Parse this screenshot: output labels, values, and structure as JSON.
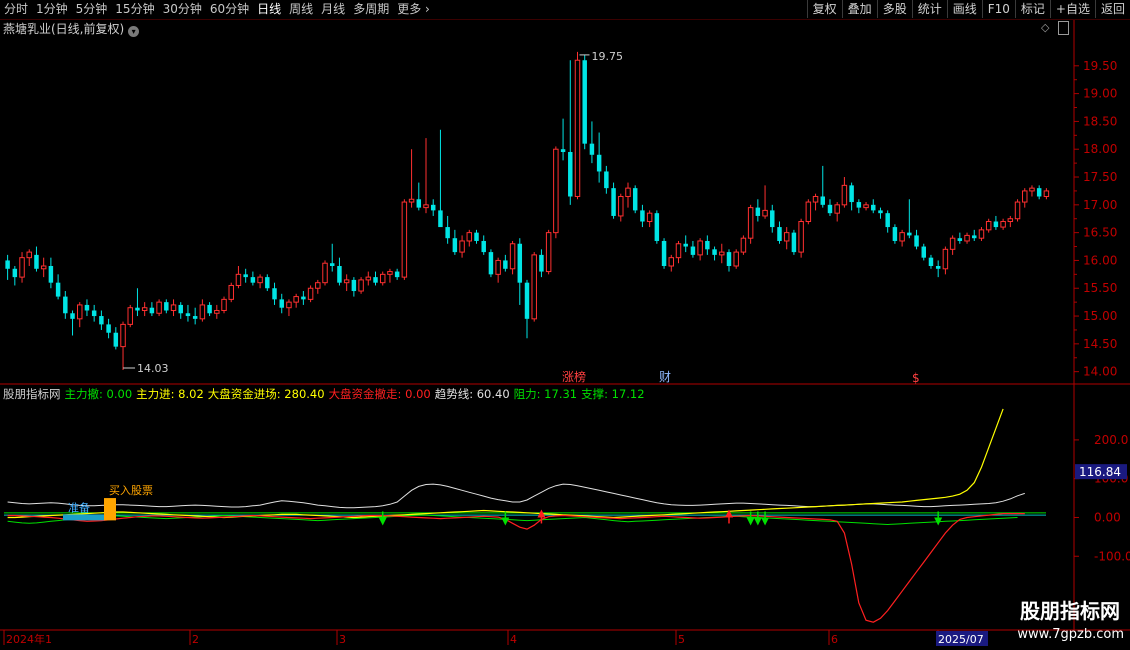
{
  "toolbar": {
    "left_items": [
      "分时",
      "1分钟",
      "5分钟",
      "15分钟",
      "30分钟",
      "60分钟",
      "日线",
      "周线",
      "月线",
      "多周期",
      "更多"
    ],
    "active_item": "日线",
    "right_buttons": [
      "复权",
      "叠加",
      "多股",
      "统计",
      "画线",
      "F10",
      "标记",
      "+自选",
      "返回"
    ]
  },
  "main_title": "燕塘乳业(日线,前复权)",
  "price_axis": {
    "ticks": [
      "19.50",
      "19.00",
      "18.50",
      "18.00",
      "17.50",
      "17.00",
      "16.50",
      "16.00",
      "15.50",
      "15.00",
      "14.50",
      "14.00"
    ]
  },
  "high_label": "19.75",
  "low_label": "14.03",
  "event_markers": [
    "涨榜",
    "财",
    "$"
  ],
  "indicator": {
    "name": "股朋指标网",
    "items": [
      {
        "label": "主力撤:",
        "value": "0.00",
        "color": "#00e000"
      },
      {
        "label": "主力进:",
        "value": "8.02",
        "color": "#ffff00"
      },
      {
        "label": "大盘资金进场:",
        "value": "280.40",
        "color": "#ffff00"
      },
      {
        "label": "大盘资金撤走:",
        "value": "0.00",
        "color": "#ff2020"
      },
      {
        "label": "趋势线:",
        "value": "60.40",
        "color": "#e0e0e0"
      },
      {
        "label": "阻力:",
        "value": "17.31",
        "color": "#00e000"
      },
      {
        "label": "支撑:",
        "value": "17.12",
        "color": "#00e000"
      }
    ],
    "ticks": [
      "200.0",
      "100.0",
      "0.00",
      "-100.0"
    ],
    "current_value": "116.84",
    "label_prepare": "准备",
    "label_buy": "买入股票"
  },
  "date_axis": [
    "2024年1",
    "2",
    "3",
    "4",
    "5",
    "6",
    "2025/07"
  ],
  "watermark": {
    "line1": "股朋指标网",
    "line2": "www.7gpzb.com"
  },
  "colors": {
    "up": "#ff3030",
    "down": "#00e5e5",
    "axis": "#b00000"
  },
  "chart_data": {
    "type": "candlestick",
    "title": "燕塘乳业(日线,前复权)",
    "ylim": [
      13.85,
      20.0
    ],
    "high": 19.75,
    "low": 14.03,
    "candles": [
      [
        16.0,
        16.1,
        15.65,
        15.85
      ],
      [
        15.85,
        15.9,
        15.55,
        15.7
      ],
      [
        15.7,
        16.15,
        15.6,
        16.05
      ],
      [
        16.05,
        16.2,
        15.9,
        16.15
      ],
      [
        16.1,
        16.25,
        15.8,
        15.85
      ],
      [
        15.85,
        16.05,
        15.7,
        15.9
      ],
      [
        15.9,
        16.05,
        15.5,
        15.6
      ],
      [
        15.6,
        15.75,
        15.3,
        15.35
      ],
      [
        15.35,
        15.45,
        14.95,
        15.05
      ],
      [
        15.05,
        15.1,
        14.65,
        14.95
      ],
      [
        14.95,
        15.25,
        14.8,
        15.2
      ],
      [
        15.2,
        15.3,
        15.0,
        15.1
      ],
      [
        15.1,
        15.2,
        14.9,
        15.0
      ],
      [
        15.0,
        15.1,
        14.75,
        14.85
      ],
      [
        14.85,
        14.95,
        14.6,
        14.7
      ],
      [
        14.7,
        14.8,
        14.4,
        14.45
      ],
      [
        14.45,
        14.9,
        14.03,
        14.85
      ],
      [
        14.85,
        15.2,
        14.8,
        15.15
      ],
      [
        15.15,
        15.5,
        15.0,
        15.1
      ],
      [
        15.1,
        15.25,
        15.0,
        15.15
      ],
      [
        15.15,
        15.25,
        15.0,
        15.05
      ],
      [
        15.05,
        15.3,
        15.0,
        15.25
      ],
      [
        15.25,
        15.3,
        15.05,
        15.1
      ],
      [
        15.1,
        15.3,
        15.0,
        15.2
      ],
      [
        15.2,
        15.25,
        14.95,
        15.05
      ],
      [
        15.05,
        15.2,
        14.9,
        15.0
      ],
      [
        15.0,
        15.15,
        14.85,
        14.95
      ],
      [
        14.95,
        15.3,
        14.9,
        15.2
      ],
      [
        15.2,
        15.25,
        15.0,
        15.05
      ],
      [
        15.05,
        15.2,
        14.95,
        15.1
      ],
      [
        15.1,
        15.35,
        15.05,
        15.3
      ],
      [
        15.3,
        15.6,
        15.25,
        15.55
      ],
      [
        15.55,
        15.9,
        15.5,
        15.75
      ],
      [
        15.75,
        15.85,
        15.6,
        15.7
      ],
      [
        15.7,
        15.8,
        15.55,
        15.6
      ],
      [
        15.6,
        15.75,
        15.5,
        15.7
      ],
      [
        15.7,
        15.75,
        15.45,
        15.5
      ],
      [
        15.5,
        15.6,
        15.2,
        15.3
      ],
      [
        15.3,
        15.4,
        15.05,
        15.15
      ],
      [
        15.15,
        15.3,
        15.0,
        15.25
      ],
      [
        15.25,
        15.4,
        15.15,
        15.35
      ],
      [
        15.35,
        15.45,
        15.2,
        15.3
      ],
      [
        15.3,
        15.55,
        15.25,
        15.5
      ],
      [
        15.5,
        15.65,
        15.4,
        15.6
      ],
      [
        15.6,
        16.0,
        15.55,
        15.95
      ],
      [
        15.95,
        16.3,
        15.8,
        15.9
      ],
      [
        15.9,
        16.05,
        15.55,
        15.6
      ],
      [
        15.6,
        15.75,
        15.45,
        15.65
      ],
      [
        15.65,
        15.7,
        15.35,
        15.45
      ],
      [
        15.45,
        15.7,
        15.4,
        15.65
      ],
      [
        15.65,
        15.8,
        15.55,
        15.7
      ],
      [
        15.7,
        15.8,
        15.55,
        15.6
      ],
      [
        15.6,
        15.8,
        15.55,
        15.75
      ],
      [
        15.75,
        15.85,
        15.6,
        15.8
      ],
      [
        15.8,
        15.85,
        15.65,
        15.7
      ],
      [
        15.7,
        17.1,
        15.65,
        17.05
      ],
      [
        17.05,
        18.0,
        16.95,
        17.1
      ],
      [
        17.1,
        17.4,
        16.9,
        16.95
      ],
      [
        16.95,
        18.2,
        16.85,
        17.0
      ],
      [
        17.0,
        17.1,
        16.8,
        16.9
      ],
      [
        16.9,
        18.35,
        16.7,
        16.6
      ],
      [
        16.6,
        16.8,
        16.3,
        16.4
      ],
      [
        16.4,
        16.55,
        16.1,
        16.15
      ],
      [
        16.15,
        16.45,
        16.05,
        16.35
      ],
      [
        16.35,
        16.55,
        16.25,
        16.5
      ],
      [
        16.5,
        16.55,
        16.3,
        16.35
      ],
      [
        16.35,
        16.45,
        16.1,
        16.15
      ],
      [
        16.15,
        16.2,
        15.7,
        15.75
      ],
      [
        15.75,
        16.05,
        15.6,
        16.0
      ],
      [
        16.0,
        16.1,
        15.8,
        15.85
      ],
      [
        15.85,
        16.35,
        15.75,
        16.3
      ],
      [
        16.3,
        16.4,
        15.2,
        15.6
      ],
      [
        15.6,
        15.65,
        14.6,
        14.95
      ],
      [
        14.95,
        16.15,
        14.9,
        16.1
      ],
      [
        16.1,
        16.2,
        15.7,
        15.8
      ],
      [
        15.8,
        16.55,
        15.75,
        16.5
      ],
      [
        16.5,
        18.05,
        16.4,
        18.0
      ],
      [
        18.0,
        18.55,
        17.8,
        17.95
      ],
      [
        17.95,
        19.6,
        17.0,
        17.15
      ],
      [
        17.15,
        19.75,
        17.1,
        19.6
      ],
      [
        19.6,
        19.7,
        18.0,
        18.1
      ],
      [
        18.1,
        18.5,
        17.75,
        17.9
      ],
      [
        17.9,
        18.3,
        17.4,
        17.6
      ],
      [
        17.6,
        17.7,
        17.2,
        17.3
      ],
      [
        17.3,
        17.4,
        16.75,
        16.8
      ],
      [
        16.8,
        17.2,
        16.7,
        17.15
      ],
      [
        17.15,
        17.4,
        16.95,
        17.3
      ],
      [
        17.3,
        17.35,
        16.85,
        16.9
      ],
      [
        16.9,
        17.0,
        16.6,
        16.7
      ],
      [
        16.7,
        16.9,
        16.6,
        16.85
      ],
      [
        16.85,
        16.9,
        16.3,
        16.35
      ],
      [
        16.35,
        16.4,
        15.85,
        15.9
      ],
      [
        15.9,
        16.1,
        15.8,
        16.05
      ],
      [
        16.05,
        16.35,
        15.95,
        16.3
      ],
      [
        16.3,
        16.45,
        16.15,
        16.25
      ],
      [
        16.25,
        16.35,
        16.05,
        16.1
      ],
      [
        16.1,
        16.4,
        16.0,
        16.35
      ],
      [
        16.35,
        16.45,
        16.1,
        16.2
      ],
      [
        16.2,
        16.25,
        16.0,
        16.1
      ],
      [
        16.1,
        16.3,
        15.95,
        16.15
      ],
      [
        16.15,
        16.2,
        15.8,
        15.9
      ],
      [
        15.9,
        16.2,
        15.85,
        16.15
      ],
      [
        16.15,
        16.45,
        16.1,
        16.4
      ],
      [
        16.4,
        17.0,
        16.3,
        16.95
      ],
      [
        16.95,
        17.1,
        16.7,
        16.8
      ],
      [
        16.8,
        17.35,
        16.75,
        16.9
      ],
      [
        16.9,
        17.0,
        16.5,
        16.6
      ],
      [
        16.6,
        16.7,
        16.3,
        16.35
      ],
      [
        16.35,
        16.6,
        16.2,
        16.5
      ],
      [
        16.5,
        16.55,
        16.1,
        16.15
      ],
      [
        16.15,
        16.75,
        16.05,
        16.7
      ],
      [
        16.7,
        17.1,
        16.65,
        17.05
      ],
      [
        17.05,
        17.2,
        16.9,
        17.15
      ],
      [
        17.15,
        17.7,
        16.95,
        17.0
      ],
      [
        17.0,
        17.1,
        16.8,
        16.85
      ],
      [
        16.85,
        17.05,
        16.7,
        17.0
      ],
      [
        17.0,
        17.5,
        16.95,
        17.35
      ],
      [
        17.35,
        17.4,
        16.9,
        17.05
      ],
      [
        17.05,
        17.1,
        16.85,
        16.95
      ],
      [
        16.95,
        17.05,
        16.9,
        17.0
      ],
      [
        17.0,
        17.1,
        16.85,
        16.9
      ],
      [
        16.9,
        16.95,
        16.75,
        16.85
      ],
      [
        16.85,
        16.9,
        16.5,
        16.6
      ],
      [
        16.6,
        16.65,
        16.3,
        16.35
      ],
      [
        16.35,
        16.55,
        16.25,
        16.5
      ],
      [
        16.5,
        17.1,
        16.4,
        16.45
      ],
      [
        16.45,
        16.55,
        16.2,
        16.25
      ],
      [
        16.25,
        16.3,
        16.0,
        16.05
      ],
      [
        16.05,
        16.1,
        15.85,
        15.9
      ],
      [
        15.9,
        16.0,
        15.7,
        15.85
      ],
      [
        15.85,
        16.25,
        15.75,
        16.2
      ],
      [
        16.2,
        16.45,
        16.1,
        16.4
      ],
      [
        16.4,
        16.5,
        16.3,
        16.35
      ],
      [
        16.35,
        16.5,
        16.3,
        16.45
      ],
      [
        16.45,
        16.55,
        16.35,
        16.4
      ],
      [
        16.4,
        16.6,
        16.35,
        16.55
      ],
      [
        16.55,
        16.75,
        16.5,
        16.7
      ],
      [
        16.7,
        16.8,
        16.55,
        16.6
      ],
      [
        16.6,
        16.75,
        16.55,
        16.7
      ],
      [
        16.7,
        16.8,
        16.6,
        16.75
      ],
      [
        16.75,
        17.1,
        16.7,
        17.05
      ],
      [
        17.05,
        17.3,
        16.95,
        17.25
      ],
      [
        17.25,
        17.35,
        17.15,
        17.3
      ],
      [
        17.3,
        17.35,
        17.1,
        17.15
      ],
      [
        17.15,
        17.3,
        17.1,
        17.25
      ]
    ],
    "indicator_series": {
      "ylim": [
        -285,
        290
      ],
      "trend": [
        40,
        38,
        36,
        35,
        36,
        37,
        38,
        37,
        35,
        33,
        31,
        30,
        30,
        31,
        32,
        33,
        33,
        32,
        31,
        30,
        29,
        28,
        28,
        29,
        30,
        31,
        32,
        31,
        30,
        29,
        28,
        27,
        27,
        28,
        30,
        32,
        36,
        40,
        43,
        42,
        40,
        38,
        35,
        32,
        30,
        28,
        26,
        25,
        25,
        26,
        27,
        28,
        30,
        34,
        40,
        55,
        70,
        80,
        85,
        86,
        84,
        80,
        75,
        70,
        65,
        60,
        55,
        50,
        46,
        43,
        40,
        40,
        45,
        55,
        65,
        75,
        82,
        86,
        85,
        82,
        78,
        74,
        70,
        66,
        62,
        58,
        54,
        50,
        46,
        42,
        38,
        35,
        33,
        32,
        31,
        31,
        32,
        33,
        34,
        35,
        36,
        37,
        37,
        36,
        35,
        34,
        33,
        32,
        31,
        30,
        29,
        28,
        28,
        29,
        30,
        31,
        32,
        33,
        34,
        35,
        35,
        34,
        33,
        32,
        31,
        30,
        29,
        28,
        28,
        29,
        30,
        31,
        32,
        33,
        34,
        35,
        36,
        38,
        42,
        48,
        56,
        62
      ],
      "red": [
        5,
        5,
        4,
        3,
        2,
        1,
        0,
        -2,
        -4,
        -6,
        -8,
        -10,
        -9,
        -8,
        -6,
        -4,
        -2,
        0,
        2,
        3,
        4,
        4,
        3,
        2,
        1,
        0,
        -1,
        -2,
        -1,
        0,
        1,
        2,
        3,
        4,
        5,
        4,
        3,
        2,
        1,
        0,
        -1,
        -2,
        -3,
        -2,
        -1,
        0,
        1,
        2,
        3,
        4,
        5,
        5,
        5,
        4,
        3,
        2,
        1,
        0,
        -1,
        -2,
        -3,
        -2,
        -1,
        0,
        1,
        2,
        3,
        2,
        1,
        -5,
        -15,
        -25,
        -30,
        -20,
        -5,
        2,
        4,
        5,
        4,
        3,
        2,
        1,
        0,
        -1,
        -2,
        -3,
        -2,
        -1,
        0,
        1,
        2,
        3,
        2,
        1,
        0,
        -1,
        -2,
        -1,
        0,
        1,
        2,
        3,
        4,
        5,
        4,
        3,
        2,
        1,
        0,
        -1,
        -2,
        -3,
        -4,
        -5,
        -6,
        -10,
        -40,
        -120,
        -220,
        -265,
        -270,
        -260,
        -240,
        -215,
        -190,
        -165,
        -140,
        -115,
        -90,
        -65,
        -40,
        -20,
        -5,
        0,
        2,
        4,
        6,
        8,
        10,
        10,
        10,
        10
      ],
      "yellow": [
        0,
        0,
        1,
        2,
        3,
        4,
        5,
        6,
        7,
        8,
        9,
        10,
        11,
        12,
        13,
        14,
        14,
        13,
        12,
        11,
        10,
        9,
        8,
        7,
        6,
        5,
        4,
        3,
        2,
        1,
        0,
        1,
        2,
        3,
        4,
        5,
        6,
        7,
        8,
        8,
        8,
        7,
        6,
        5,
        4,
        3,
        2,
        1,
        0,
        1,
        2,
        3,
        4,
        5,
        6,
        7,
        8,
        9,
        10,
        11,
        12,
        13,
        14,
        15,
        16,
        17,
        18,
        17,
        16,
        15,
        14,
        13,
        12,
        11,
        10,
        9,
        8,
        7,
        6,
        5,
        4,
        3,
        2,
        1,
        0,
        1,
        2,
        3,
        4,
        5,
        6,
        7,
        8,
        9,
        10,
        11,
        12,
        13,
        14,
        15,
        16,
        17,
        18,
        19,
        20,
        21,
        22,
        23,
        24,
        25,
        26,
        27,
        28,
        29,
        30,
        31,
        32,
        33,
        34,
        35,
        36,
        37,
        38,
        39,
        40,
        42,
        44,
        46,
        48,
        50,
        52,
        55,
        60,
        70,
        90,
        130,
        180,
        230,
        280
      ],
      "green": [
        -10,
        -12,
        -14,
        -15,
        -14,
        -12,
        -10,
        -8,
        -6,
        -4,
        -2,
        0,
        2,
        3,
        4,
        4,
        3,
        2,
        1,
        0,
        -1,
        -2,
        -3,
        -2,
        -1,
        0,
        1,
        2,
        3,
        4,
        5,
        4,
        3,
        2,
        1,
        0,
        -1,
        -2,
        -3,
        -4,
        -5,
        -6,
        -7,
        -8,
        -7,
        -6,
        -5,
        -4,
        -3,
        -2,
        -1,
        0,
        1,
        2,
        3,
        4,
        5,
        6,
        6,
        5,
        4,
        3,
        2,
        1,
        0,
        -1,
        -2,
        -3,
        -4,
        -5,
        -6,
        -7,
        -8,
        -7,
        -6,
        -5,
        -4,
        -3,
        -2,
        -1,
        0,
        -2,
        -4,
        -6,
        -8,
        -10,
        -11,
        -10,
        -9,
        -8,
        -7,
        -6,
        -5,
        -4,
        -3,
        -2,
        -1,
        0,
        1,
        2,
        3,
        3,
        2,
        1,
        0,
        -1,
        -2,
        -3,
        -4,
        -5,
        -6,
        -7,
        -8,
        -9,
        -10,
        -11,
        -12,
        -13,
        -14,
        -15,
        -16,
        -17,
        -18,
        -17,
        -16,
        -15,
        -14,
        -13,
        -12,
        -11,
        -10,
        -9,
        -8,
        -7,
        -6,
        -5,
        -4,
        -3,
        -2,
        -1,
        0
      ],
      "up_arrows": [
        74,
        100
      ],
      "down_arrows": [
        52,
        69,
        103,
        104,
        105,
        129
      ]
    }
  }
}
